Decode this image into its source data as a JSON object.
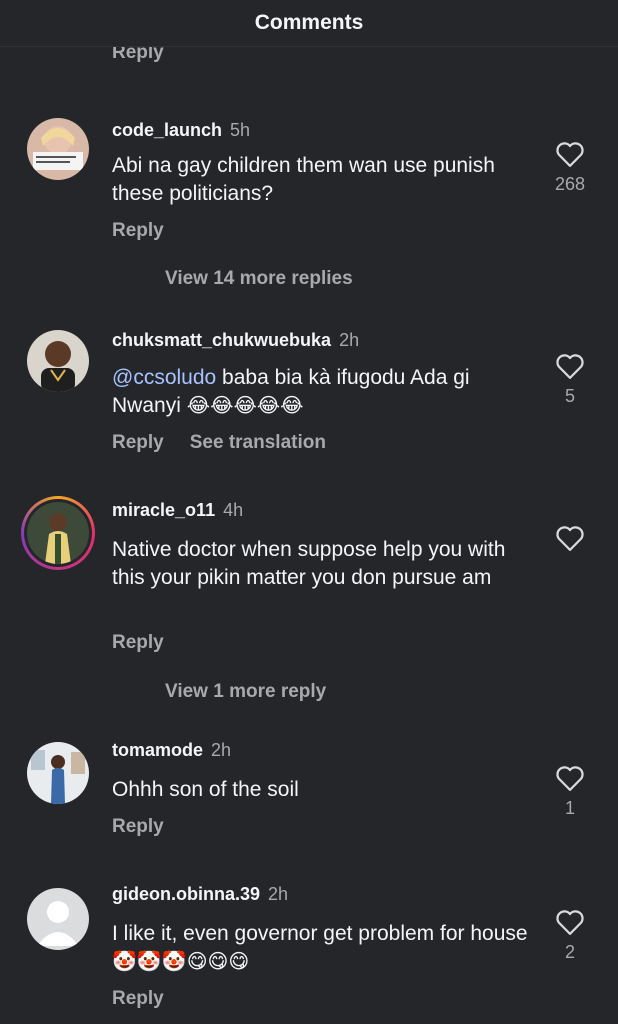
{
  "header": {
    "title": "Comments"
  },
  "top_reply": "Reply",
  "comments": [
    {
      "username": "code_launch",
      "time": "5h",
      "text": "Abi na gay children them wan use punish these politicians?",
      "reply_label": "Reply",
      "like_count": "268",
      "view_more": "View 14 more replies"
    },
    {
      "username": "chuksmatt_chukwuebuka",
      "time": "2h",
      "mention": "@ccsoludo",
      "text": " baba bia kà ifugodu Ada gi Nwanyi",
      "emoji": "😂😂😂😂😂",
      "reply_label": "Reply",
      "translate_label": "See translation",
      "like_count": "5"
    },
    {
      "username": "miracle_o11",
      "time": "4h",
      "text": "Native doctor when suppose help you with this your pikin matter you don pursue am",
      "reply_label": "Reply",
      "like_count": "",
      "view_more": "View 1 more reply"
    },
    {
      "username": "tomamode",
      "time": "2h",
      "text": "Ohhh son of the soil",
      "reply_label": "Reply",
      "like_count": "1"
    },
    {
      "username": "gideon.obinna.39",
      "time": "2h",
      "text": "I like it, even governor get problem for house",
      "emoji": "🤡🤡🤡😋😋😋",
      "reply_label": "Reply",
      "like_count": "2"
    }
  ],
  "icons": {
    "like": "heart-outline-icon",
    "default_avatar": "person-silhouette-icon"
  }
}
